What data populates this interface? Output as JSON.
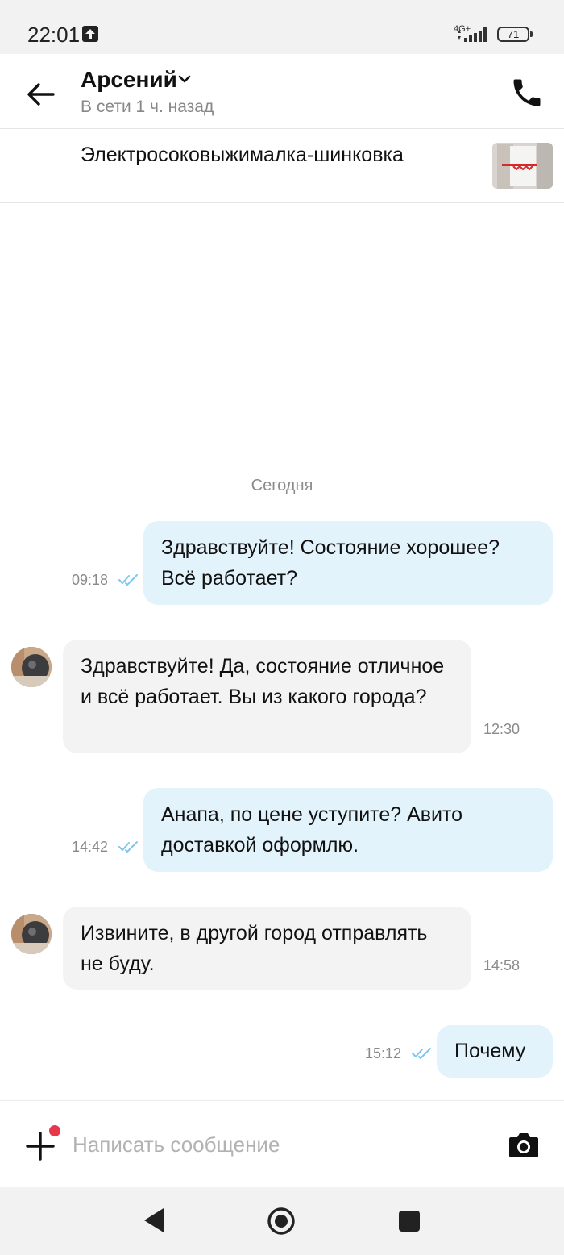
{
  "status_bar": {
    "time": "22:01",
    "network": "4G+",
    "battery": "71"
  },
  "header": {
    "contact_name": "Арсений",
    "contact_status": "В сети 1 ч. назад"
  },
  "item": {
    "title": "Электросоковыжималка-шинковка"
  },
  "chat": {
    "date_separator": "Сегодня",
    "messages": [
      {
        "direction": "out",
        "text": "Здравствуйте! Состояние хорошее? Всё работает?",
        "time": "09:18",
        "read": true
      },
      {
        "direction": "in",
        "text": "Здравствуйте! Да, состояние отличное и всё работает. Вы из какого города?",
        "time": "12:30"
      },
      {
        "direction": "out",
        "text": "Анапа, по цене уступите? Авито доставкой оформлю.",
        "time": "14:42",
        "read": true
      },
      {
        "direction": "in",
        "text": "Извините, в другой город отправлять не буду.",
        "time": "14:58"
      },
      {
        "direction": "out",
        "text": "Почему",
        "time": "15:12",
        "read": true
      }
    ]
  },
  "composer": {
    "placeholder": "Написать сообщение"
  },
  "colors": {
    "outgoing_bubble": "#e3f3fc",
    "incoming_bubble": "#f3f3f3",
    "read_check": "#7cc7ee",
    "notification_dot": "#e8364b"
  }
}
